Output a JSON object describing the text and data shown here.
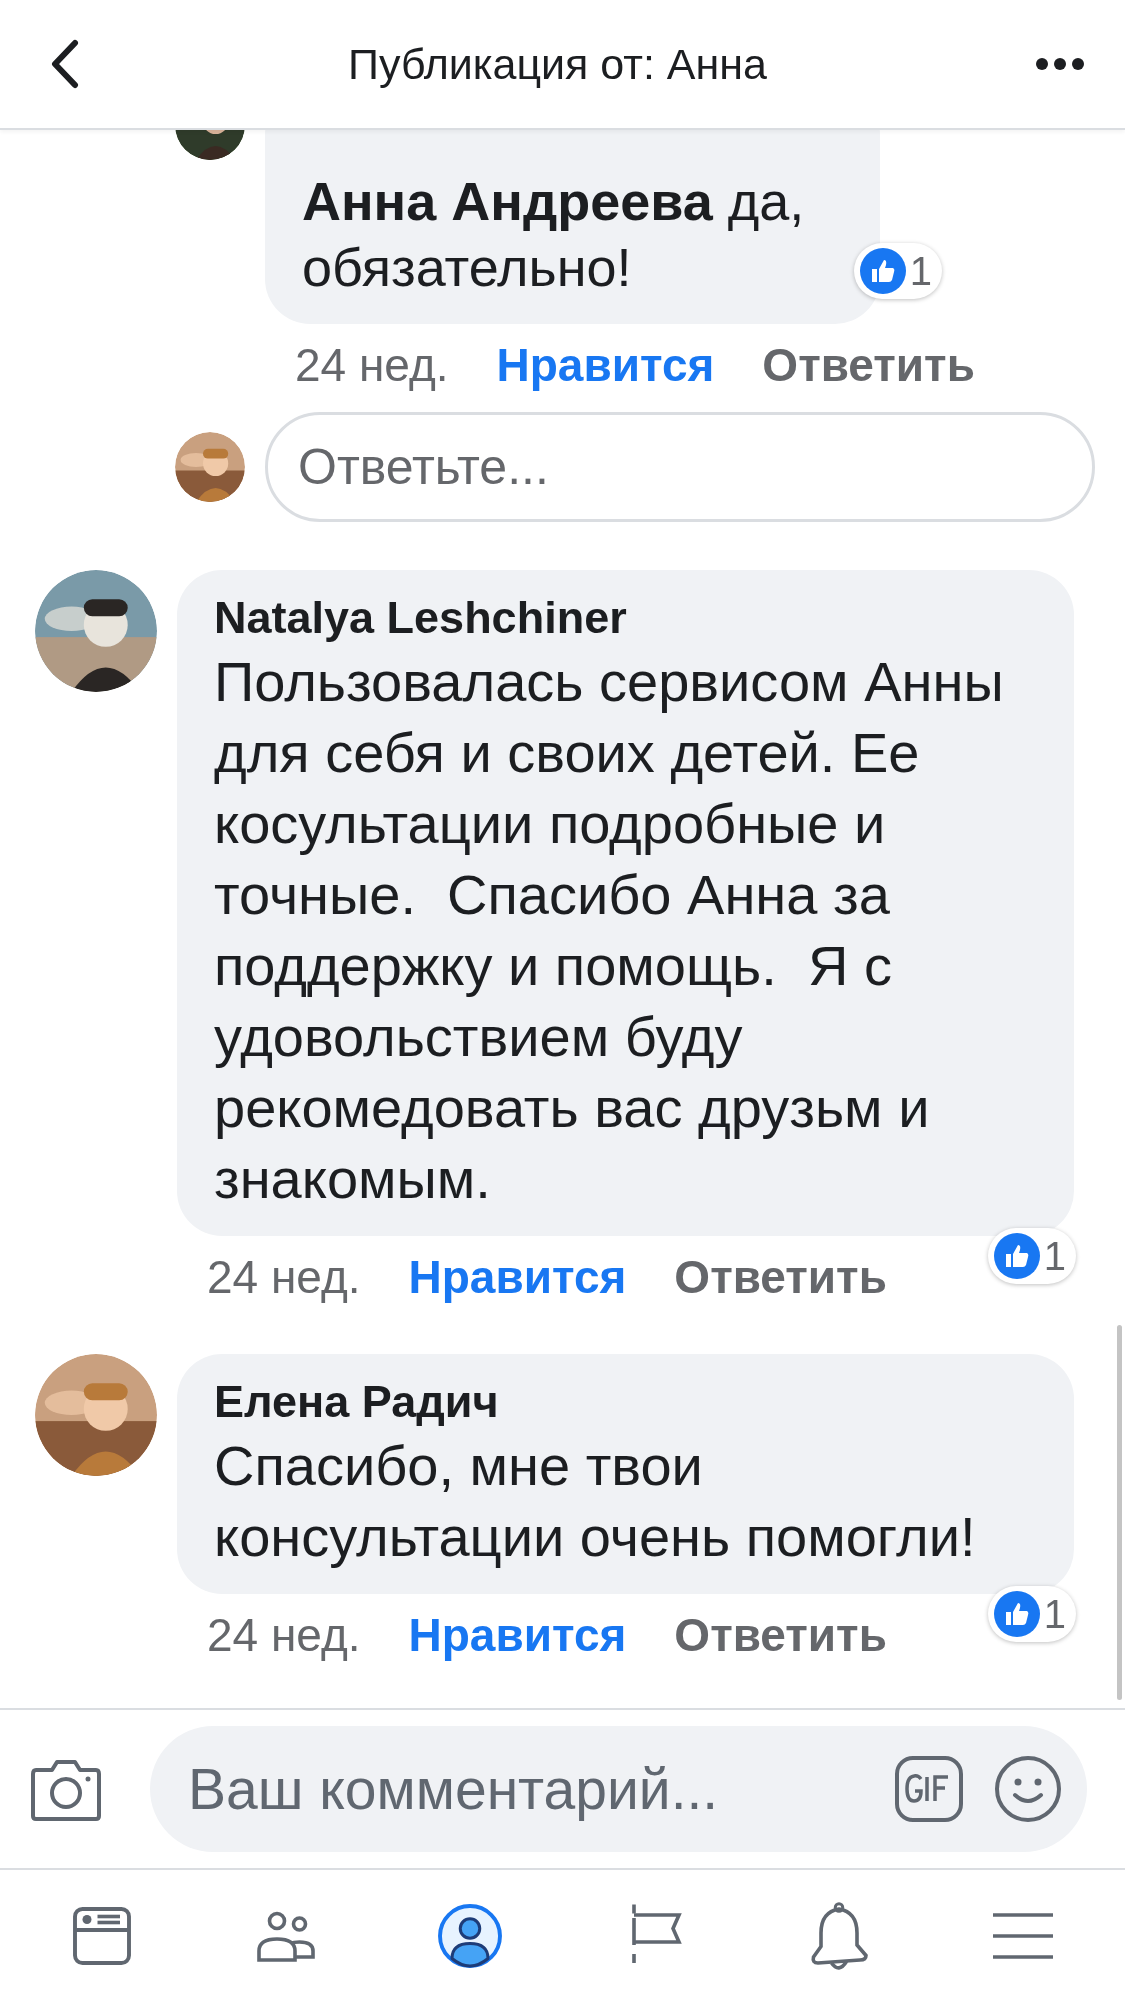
{
  "header": {
    "title": "Публикация от: Анна"
  },
  "thread": [
    {
      "kind": "reply",
      "text": "**Анна Андреева** да, обязательно!",
      "likes": "1",
      "time": "24 нед.",
      "like_label": "Нравится",
      "liked": true,
      "reply_label": "Ответить"
    },
    {
      "kind": "reply_field",
      "placeholder": "Ответьте..."
    },
    {
      "kind": "comment",
      "author": "Natalya Leshchiner",
      "text": "Пользовалась сервисом Анны для себя и своих детей. Ее косультации подробные и точные.  Спасибо Анна за поддержку и помощь.  Я с удовольствием буду рекомедовать вас друзьм и знакомым.",
      "likes": "1",
      "time": "24 нед.",
      "like_label": "Нравится",
      "liked": true,
      "reply_label": "Ответить"
    },
    {
      "kind": "comment",
      "author": "Елена Радич",
      "text": "Спасибо, мне твои консультации очень помогли!",
      "likes": "1",
      "time": "24 нед.",
      "like_label": "Нравится",
      "liked": true,
      "reply_label": "Ответить"
    }
  ],
  "composer": {
    "placeholder": "Ваш комментарий..."
  },
  "tab_bar": [
    {
      "kind": "news",
      "selected": false
    },
    {
      "kind": "friends",
      "selected": false
    },
    {
      "kind": "profile",
      "selected": true
    },
    {
      "kind": "pages",
      "selected": false
    },
    {
      "kind": "notifications",
      "selected": false
    },
    {
      "kind": "menu",
      "selected": false
    }
  ]
}
